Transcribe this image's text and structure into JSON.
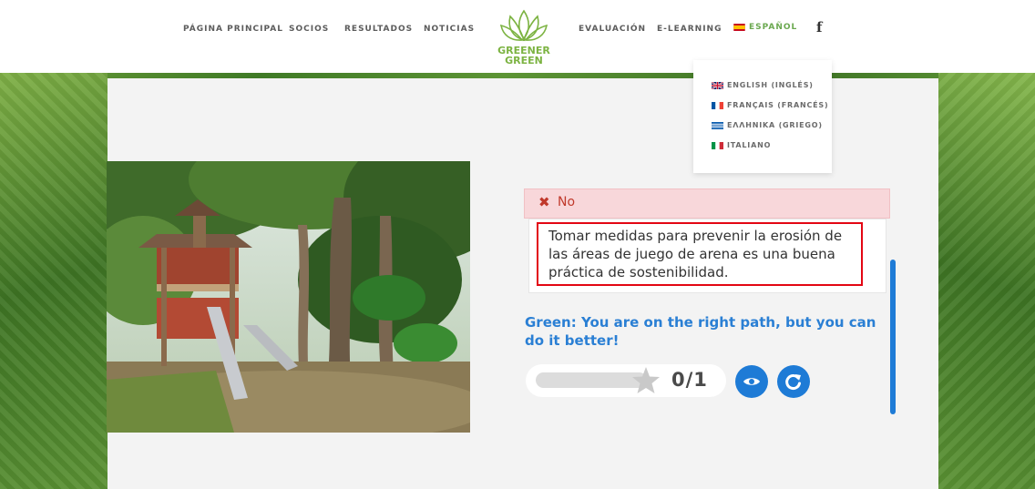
{
  "nav": {
    "left_items": [
      "PÁGINA PRINCIPAL",
      "SOCIOS",
      "RESULTADOS",
      "NOTICIAS"
    ],
    "right_items": [
      "EVALUACIÓN",
      "E-LEARNING"
    ],
    "current_language": "ESPAÑOL",
    "social_icon": "facebook-icon"
  },
  "logo": {
    "line1": "GREENER",
    "line2": "GREEN",
    "icon": "leaf-wreath-icon",
    "color": "#7cb342"
  },
  "language_menu": {
    "items": [
      "ENGLISH (INGLÉS)",
      "FRANÇAIS (FRANCÉS)",
      "ΕΛΛΗΝΙΚΑ (GRIEGO)",
      "ITALIANO"
    ]
  },
  "quiz": {
    "feedback_status": "No",
    "feedback_icon": "cross-icon",
    "statement": "Tomar medidas para prevenir la erosión de las áreas de juego de arena es una buena práctica de sostenibilidad.",
    "result_message": "Green: You are on the right path, but you can do it better!",
    "score_text": "0/1",
    "score_fraction": 0.0,
    "show_answer_icon": "eye-icon",
    "retry_icon": "retry-icon"
  },
  "colors": {
    "accent_blue": "#1e7bd6",
    "error_red": "#e30613",
    "error_bg": "#f8d7da",
    "brand_green": "#6aa84f"
  }
}
